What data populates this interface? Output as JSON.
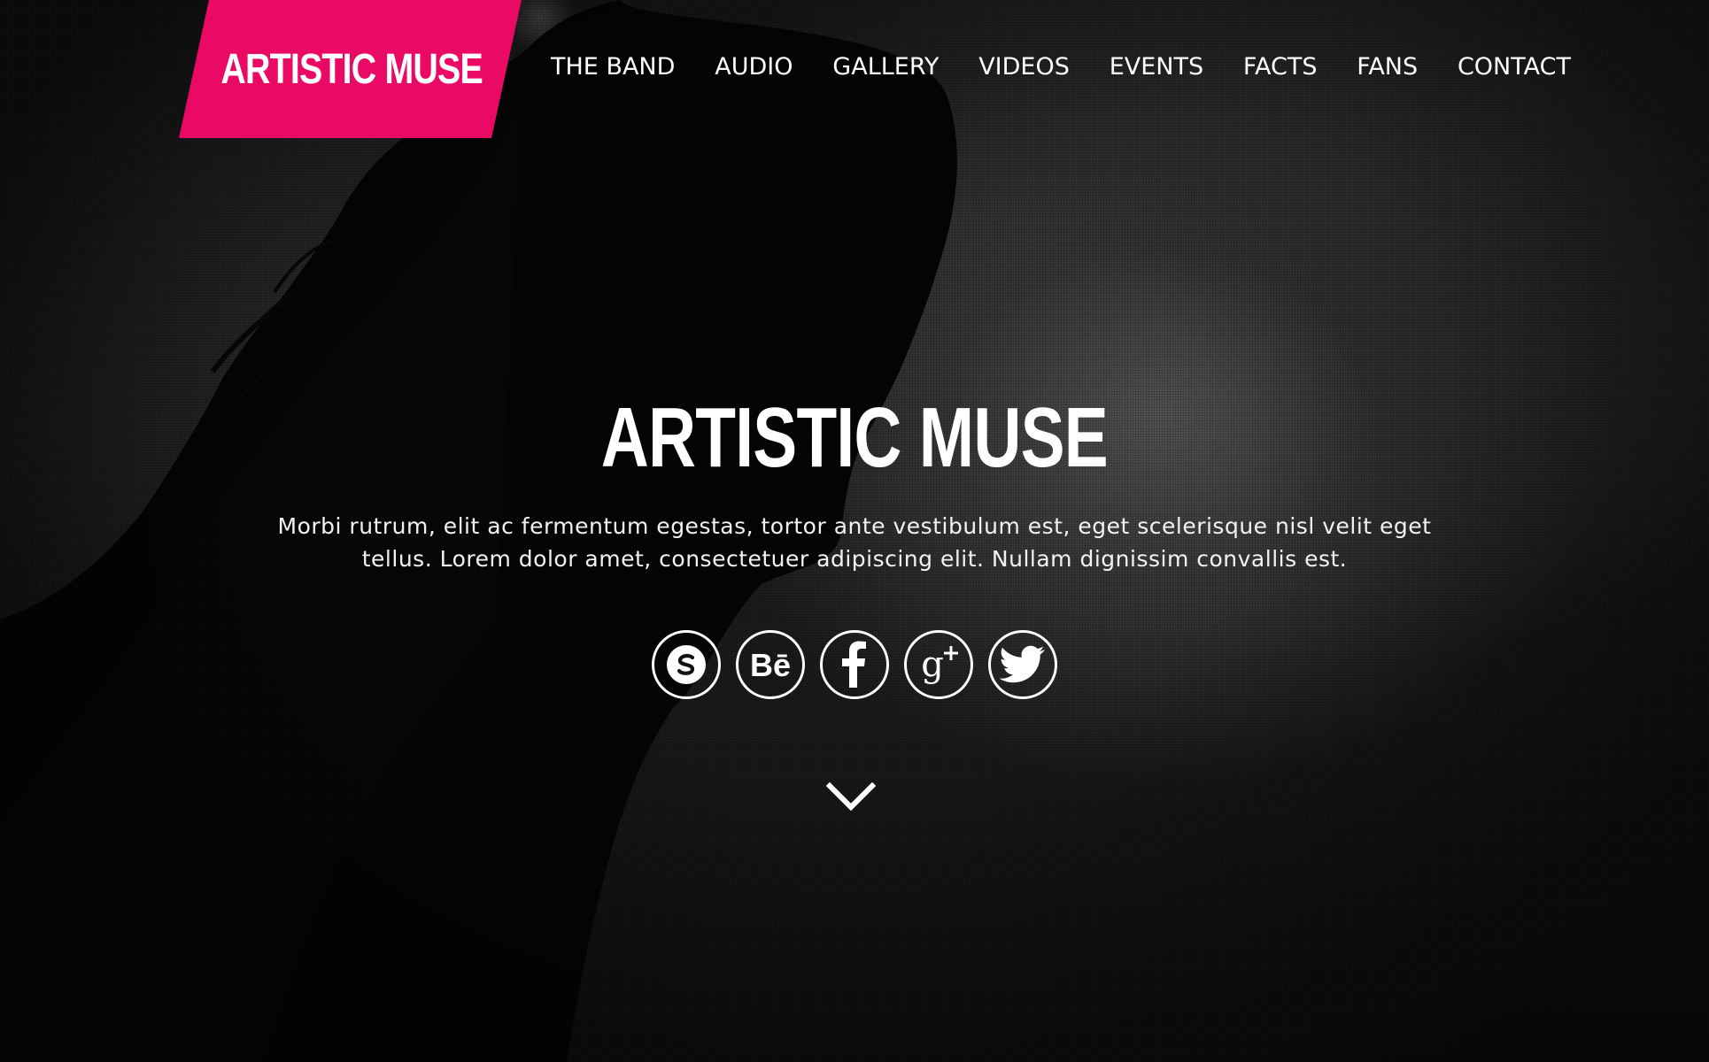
{
  "brand": {
    "name": "ARTISTIC MUSE",
    "accent_color": "#ea0a66"
  },
  "nav": {
    "items": [
      {
        "label": "THE BAND"
      },
      {
        "label": "AUDIO"
      },
      {
        "label": "GALLERY"
      },
      {
        "label": "VIDEOS"
      },
      {
        "label": "EVENTS"
      },
      {
        "label": "FACTS"
      },
      {
        "label": "FANS"
      },
      {
        "label": "CONTACT"
      }
    ]
  },
  "hero": {
    "title": "ARTISTIC MUSE",
    "text": "Morbi rutrum, elit ac fermentum egestas, tortor ante vestibulum est, eget scelerisque nisl velit eget tellus. Lorem dolor amet, consectetuer adipiscing elit. Nullam dignissim convallis est."
  },
  "social": [
    {
      "icon": "skype-icon"
    },
    {
      "icon": "behance-icon"
    },
    {
      "icon": "facebook-icon"
    },
    {
      "icon": "google-plus-icon"
    },
    {
      "icon": "twitter-icon"
    }
  ],
  "scroll_icon": "chevron-down-icon"
}
